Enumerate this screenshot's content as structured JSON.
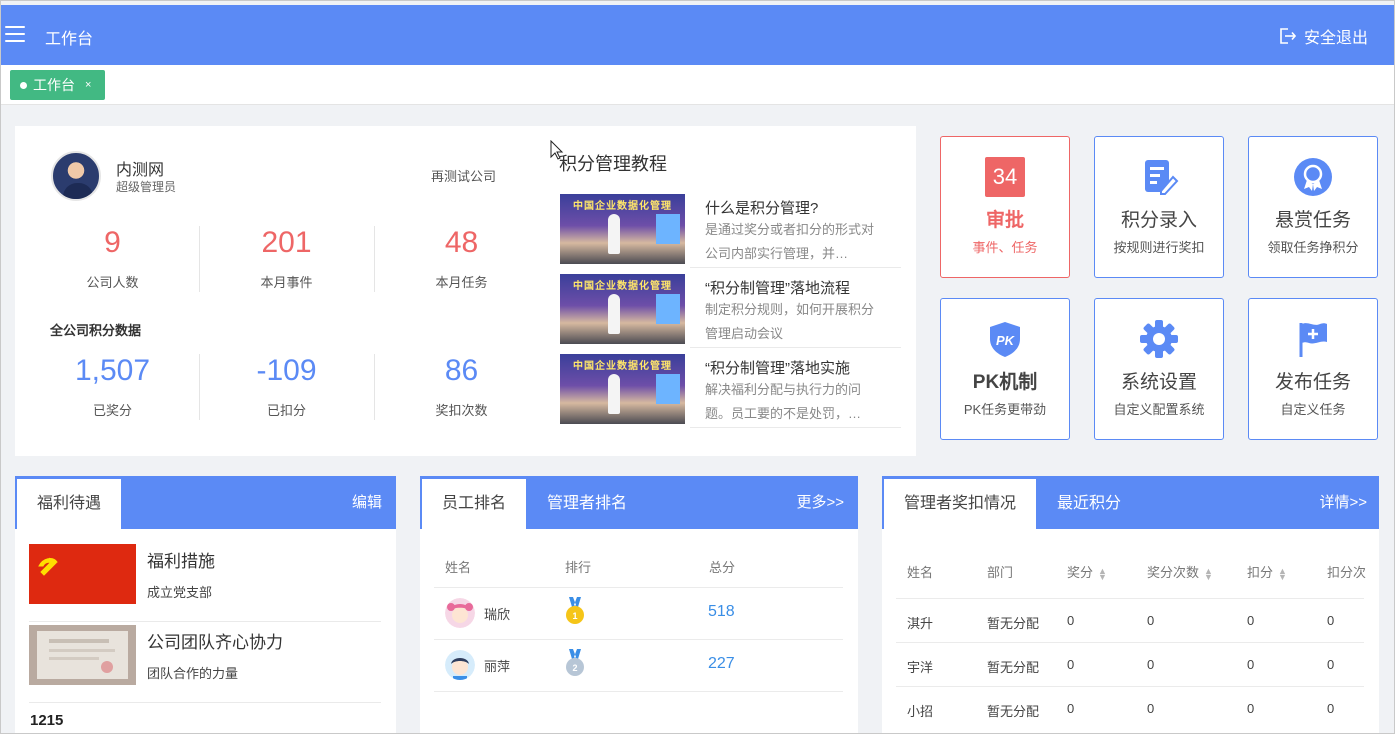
{
  "header": {
    "title": "工作台",
    "logout_label": "安全退出"
  },
  "tabs": [
    {
      "label": "工作台",
      "close": "×"
    }
  ],
  "profile": {
    "name": "内测网",
    "role": "超级管理员",
    "company": "再测试公司",
    "stats_top": [
      {
        "value": "9",
        "label": "公司人数"
      },
      {
        "value": "201",
        "label": "本月事件"
      },
      {
        "value": "48",
        "label": "本月任务"
      }
    ],
    "section_label": "全公司积分数据",
    "stats_bottom": [
      {
        "value": "1,507",
        "label": "已奖分"
      },
      {
        "value": "-109",
        "label": "已扣分"
      },
      {
        "value": "86",
        "label": "奖扣次数"
      }
    ]
  },
  "tutorial": {
    "title": "积分管理教程",
    "thumb_text": "中国企业数据化管理",
    "items": [
      {
        "title": "什么是积分管理?",
        "desc": "是通过奖分或者扣分的形式对公司内部实行管理，并…"
      },
      {
        "title": "“积分制管理”落地流程",
        "desc": "制定积分规则，如何开展积分管理启动会议"
      },
      {
        "title": "“积分制管理”落地实施",
        "desc": "解决福利分配与执行力的问题。员工要的不是处罚，…"
      }
    ]
  },
  "tiles": [
    {
      "badge": "34",
      "name": "审批",
      "sub": "事件、任务",
      "icon": "approval-badge"
    },
    {
      "name": "积分录入",
      "sub": "按规则进行奖扣",
      "icon": "edit-doc-icon"
    },
    {
      "name": "悬赏任务",
      "sub": "领取任务挣积分",
      "icon": "award-icon"
    },
    {
      "name": "PK机制",
      "sub": "PK任务更带劲",
      "icon": "pk-shield-icon"
    },
    {
      "name": "系统设置",
      "sub": "自定义配置系统",
      "icon": "gear-icon"
    },
    {
      "name": "发布任务",
      "sub": "自定义任务",
      "icon": "flag-icon"
    }
  ],
  "welfare": {
    "tab": "福利待遇",
    "edit": "编辑",
    "items": [
      {
        "title": "福利措施",
        "sub": "成立党支部"
      },
      {
        "title": "公司团队齐心协力",
        "sub": "团队合作的力量"
      }
    ],
    "extra": "1215"
  },
  "ranking": {
    "tab_active": "员工排名",
    "tab_other": "管理者排名",
    "more": "更多>>",
    "columns": [
      "姓名",
      "排行",
      "总分"
    ],
    "rows": [
      {
        "name": "瑞欣",
        "score": "518"
      },
      {
        "name": "丽萍",
        "score": "227"
      }
    ]
  },
  "manager": {
    "tab_active": "管理者奖扣情况",
    "tab_other": "最近积分",
    "detail": "详情>>",
    "columns": [
      "姓名",
      "部门",
      "奖分",
      "奖分次数",
      "扣分",
      "扣分次"
    ],
    "rows": [
      [
        "淇升",
        "暂无分配",
        "0",
        "0",
        "0",
        "0"
      ],
      [
        "宇洋",
        "暂无分配",
        "0",
        "0",
        "0",
        "0"
      ],
      [
        "小招",
        "暂无分配",
        "0",
        "0",
        "0",
        "0"
      ]
    ]
  },
  "colors": {
    "primary": "#5b8af5",
    "accent_red": "#ee6666",
    "tab_green": "#42b983",
    "score_blue": "#3a8ee6"
  }
}
